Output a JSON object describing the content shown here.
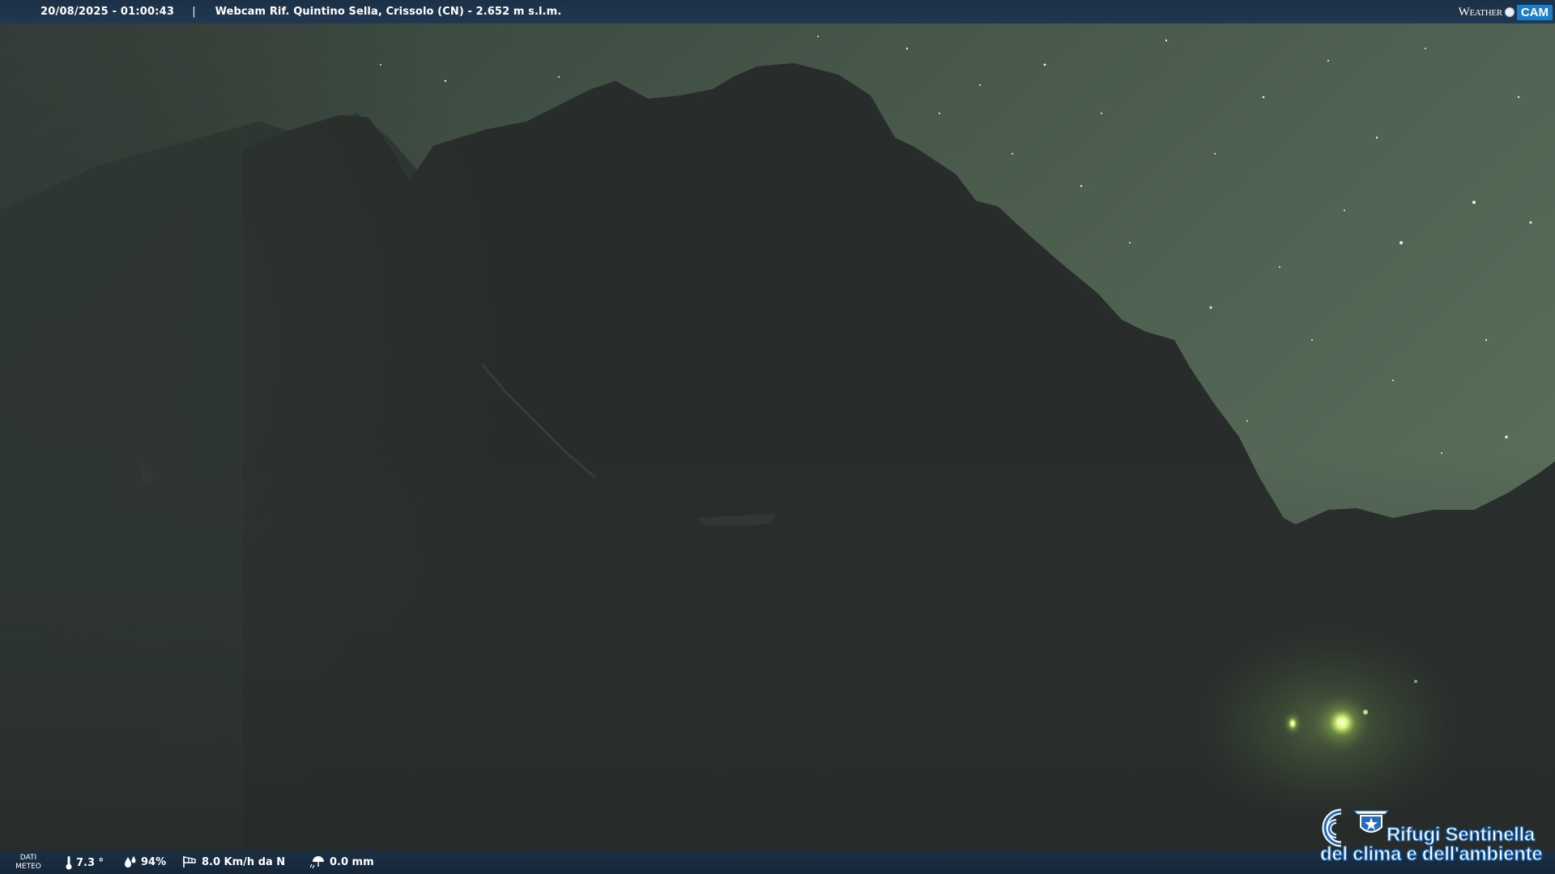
{
  "header": {
    "timestamp": "20/08/2025 - 01:00:43",
    "separator": "|",
    "title": "Webcam Rif. Quintino Sella, Crissolo (CN) - 2.652 m s.l.m.",
    "brand_weather": "Weather",
    "brand_cam": "CAM"
  },
  "weather_bar": {
    "label_line1": "DATI",
    "label_line2": "METEO",
    "temperature": "7.3 °",
    "humidity": "94%",
    "wind": "8.0 Km/h da N",
    "rain": "0.0 mm",
    "icons": {
      "temperature": "thermometer-icon",
      "humidity": "humidity-drops-icon",
      "wind": "windsock-icon",
      "rain": "rain-umbrella-icon"
    }
  },
  "logo": {
    "line1": "Rifugi Sentinella",
    "line2": "del clima e dell'ambiente",
    "icons": [
      "cnr-logo-icon",
      "cai-star-shield-icon"
    ]
  },
  "colors": {
    "bar_background": "#1c3147",
    "sky": "#4f6151",
    "mountain": "#282d2b",
    "lamp_glow": "#eaff9a",
    "logo_outline": "#1e6dc0",
    "brand_cam": "#1c7fc6"
  }
}
